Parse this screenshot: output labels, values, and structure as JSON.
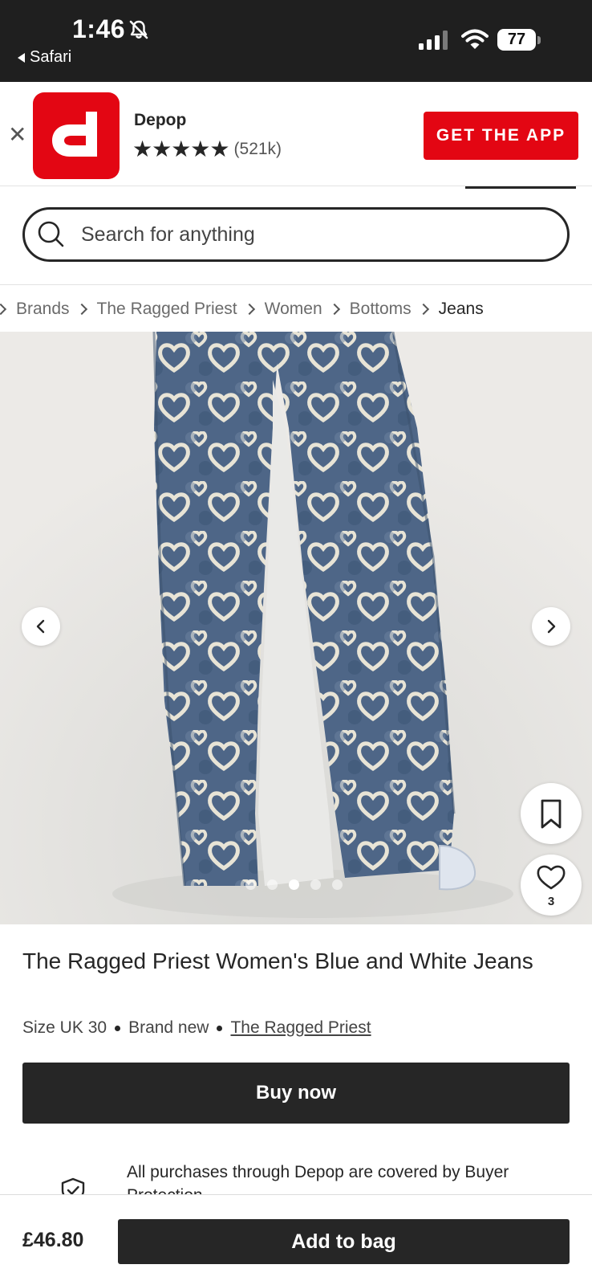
{
  "status_bar": {
    "time": "1:46",
    "back_app": "Safari",
    "battery": "77",
    "icons": [
      "bell-slash-icon",
      "signal-icon",
      "wifi-icon",
      "battery-icon"
    ]
  },
  "app_banner": {
    "close_icon": "close-icon",
    "app_name": "Depop",
    "stars": "★★★★★",
    "rating_count": "(521k)",
    "cta": "GET THE APP",
    "brand_color": "#e30613"
  },
  "search": {
    "placeholder": "Search for anything"
  },
  "breadcrumb": {
    "items": [
      "Brands",
      "The Ragged Priest",
      "Women",
      "Bottoms"
    ],
    "current": "Jeans"
  },
  "gallery": {
    "image_count": 5,
    "active_index": 2,
    "like_count": "3",
    "icons": [
      "chevron-left-icon",
      "chevron-right-icon",
      "bookmark-icon",
      "heart-icon"
    ]
  },
  "product": {
    "title": "The Ragged Priest Women's Blue and White Jeans",
    "size": "Size UK 30",
    "condition": "Brand new",
    "brand": "The Ragged Priest",
    "buy_now": "Buy now",
    "protection": "All purchases through Depop are covered by Buyer Protection."
  },
  "footer": {
    "price": "£46.80",
    "add_to_bag": "Add to bag"
  },
  "colors": {
    "dark": "#262626",
    "accent": "#e30613"
  }
}
